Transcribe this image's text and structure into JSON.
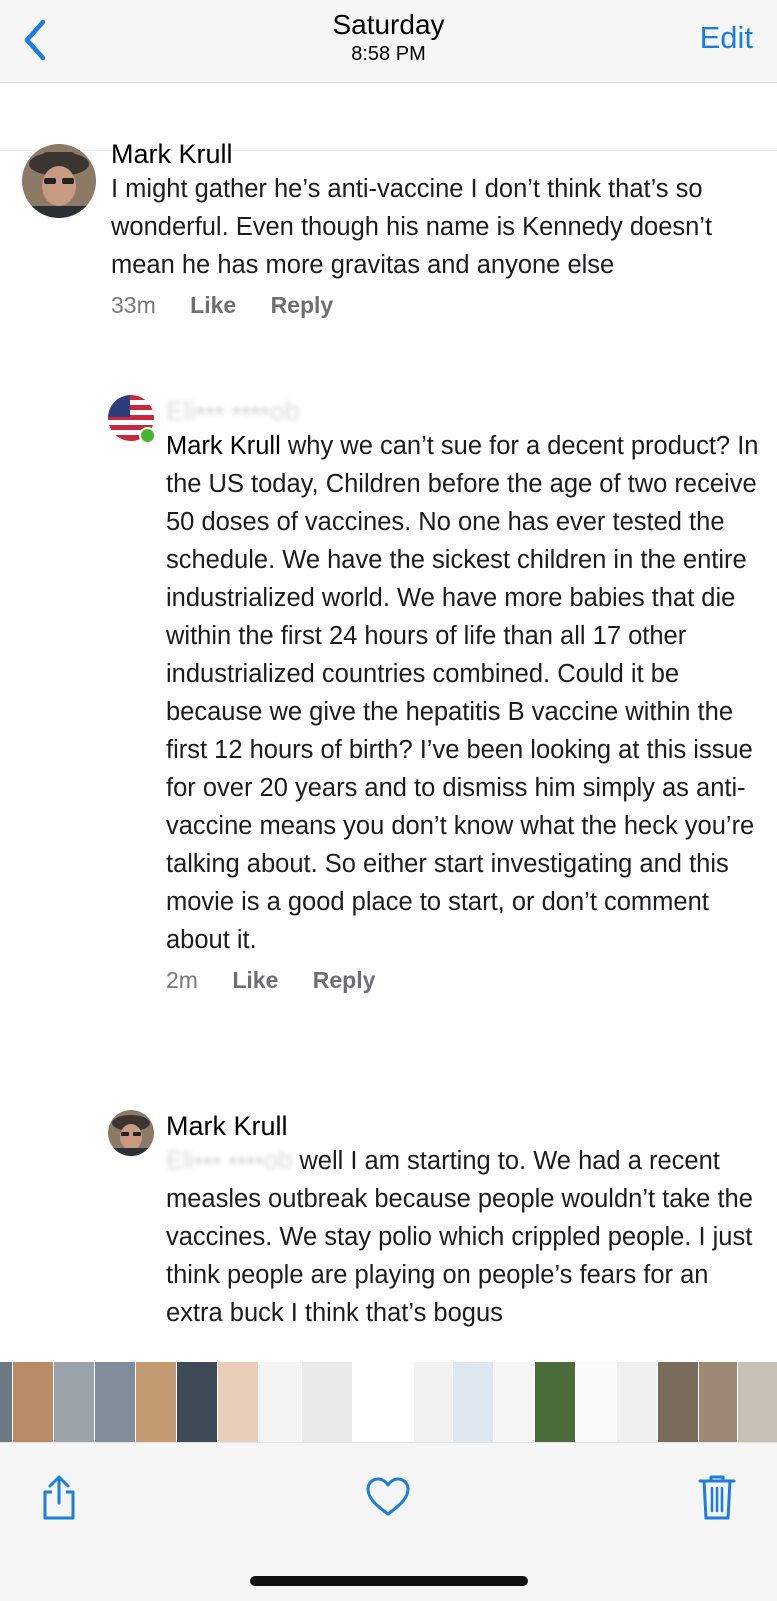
{
  "header": {
    "title": "Saturday",
    "subtitle": "8:58 PM",
    "edit_label": "Edit"
  },
  "comments": [
    {
      "author": "Mark Krull",
      "text": "I might gather he’s anti-vaccine I don’t think that’s so wonderful. Even though his name is Kennedy doesn’t mean he has more gravitas and anyone else",
      "time": "33m",
      "like_label": "Like",
      "reply_label": "Reply"
    },
    {
      "author": "Eli••• ••••ob",
      "mention": "Mark Krull",
      "text": " why we can’t sue for a decent product? In the US today, Children before the age of two receive 50 doses of vaccines. No one has ever tested the schedule. We have the sickest children in the entire industrialized world. We have more babies that die within the first 24 hours of life than all 17 other industrialized countries combined. Could it be because we give the hepatitis B vaccine within the first 12 hours of birth? I’ve been looking at this issue for over 20 years and to dismiss him simply as anti-vaccine means you don’t know what the heck you’re talking about. So either start investigating and this movie is a good place to start, or don’t comment about it.",
      "time": "2m",
      "like_label": "Like",
      "reply_label": "Reply"
    },
    {
      "author": "Mark Krull",
      "mention": "Eli••• ••••ob",
      "text": " well I am starting to. We had a recent measles outbreak because people wouldn’t take the vaccines. We stay polio which crippled people. I just think people are playing on people’s fears for an extra buck I think that’s bogus"
    }
  ],
  "photo_strip": {
    "colors": [
      "#6c7a86",
      "#b88a66",
      "#9aa3aa",
      "#7f8e9a",
      "#c49a72",
      "#3f4a58",
      "#e8cdb8",
      "#f4f4f4",
      "#eaeaea",
      "#ffffff",
      "#f2f2f2",
      "#dfe8f0",
      "#f6f6f6",
      "#4a6b3a",
      "#fafafa",
      "#f0f0f0",
      "#7b6b5a",
      "#9e8a74",
      "#c7c0b4",
      "#eeeeee",
      "#8a8f94"
    ]
  },
  "toolbar": {
    "share_icon": "share-icon",
    "heart_icon": "heart-icon",
    "trash_icon": "trash-icon",
    "accent": "#1a7ee0"
  }
}
